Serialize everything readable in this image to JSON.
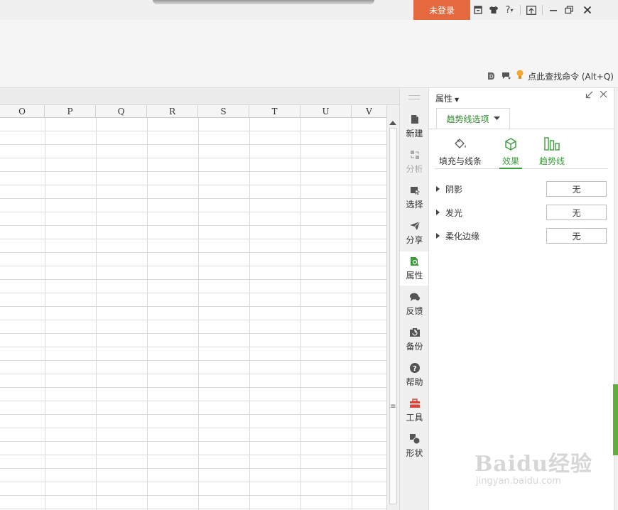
{
  "titlebar": {
    "login_label": "未登录",
    "icons": [
      "skin-box-icon",
      "tshirt-icon",
      "help-icon",
      "upload-window-icon",
      "minimize-icon",
      "restore-icon",
      "close-icon"
    ],
    "help_label": "?"
  },
  "ribbon": {
    "command_search_label": "点此查找命令 (Alt+Q)"
  },
  "sheet": {
    "columns": [
      "O",
      "P",
      "Q",
      "R",
      "S",
      "T",
      "U",
      "V"
    ]
  },
  "sidebar": {
    "items": [
      {
        "label": "新建",
        "icon": "new-doc-icon"
      },
      {
        "label": "分析",
        "icon": "analysis-icon",
        "disabled": true
      },
      {
        "label": "选择",
        "icon": "select-icon"
      },
      {
        "label": "分享",
        "icon": "share-icon"
      },
      {
        "label": "属性",
        "icon": "properties-icon",
        "active": true
      },
      {
        "label": "反馈",
        "icon": "feedback-icon"
      },
      {
        "label": "备份",
        "icon": "backup-icon"
      },
      {
        "label": "帮助",
        "icon": "help-icon"
      },
      {
        "label": "工具",
        "icon": "toolbox-icon"
      },
      {
        "label": "形状",
        "icon": "shape-icon"
      }
    ]
  },
  "panel": {
    "title": "属性",
    "dropdown_tab": "趋势线选项",
    "subtabs": [
      {
        "label": "填充与线条",
        "icon": "fill-bucket-icon"
      },
      {
        "label": "效果",
        "icon": "cube-icon",
        "selected": true
      },
      {
        "label": "趋势线",
        "icon": "bar-chart-icon"
      }
    ],
    "properties": [
      {
        "label": "阴影",
        "value": "无"
      },
      {
        "label": "发光",
        "value": "无"
      },
      {
        "label": "柔化边缘",
        "value": "无"
      }
    ]
  },
  "watermark": {
    "logo": "Baidu经验",
    "url": "jingyan.baidu.com"
  },
  "colors": {
    "accent_green": "#3c9c3c",
    "login_orange": "#e5683e"
  }
}
